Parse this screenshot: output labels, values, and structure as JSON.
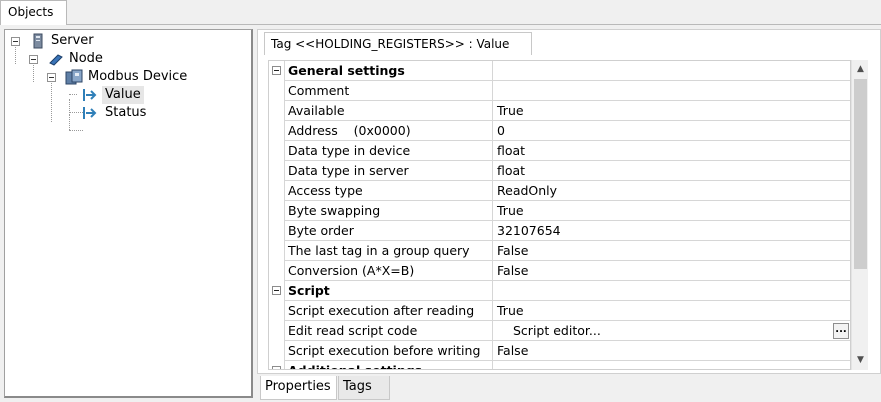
{
  "top_tab": {
    "label": "Objects"
  },
  "tree": {
    "server": "Server",
    "node": "Node",
    "device": "Modbus Device",
    "value": "Value",
    "status": "Status"
  },
  "panel": {
    "tab_label": "Tag <<HOLDING_REGISTERS>> : Value"
  },
  "grid": {
    "general_header": "General settings",
    "rows_general": [
      {
        "name": "Comment",
        "value": ""
      },
      {
        "name": "Available",
        "value": "True"
      },
      {
        "name": "Address    (0x0000)",
        "value": "0"
      },
      {
        "name": "Data type in device",
        "value": "float"
      },
      {
        "name": "Data type in server",
        "value": "float"
      },
      {
        "name": "Access type",
        "value": "ReadOnly"
      },
      {
        "name": "Byte swapping",
        "value": "True"
      },
      {
        "name": "Byte order",
        "value": "32107654"
      },
      {
        "name": "The last tag in a group query",
        "value": "False"
      },
      {
        "name": "Conversion (A*X=B)",
        "value": "False"
      }
    ],
    "script_header": "Script",
    "rows_script": [
      {
        "name": "Script execution after reading",
        "value": "True"
      },
      {
        "name": "Edit read script code",
        "value": "Script editor..."
      },
      {
        "name": "Script execution before writing",
        "value": "False"
      }
    ],
    "additional_header_partial": "Additional settings",
    "ellipsis": "..."
  },
  "scrollbar": {
    "up": "▲",
    "down": "▼"
  },
  "bottom_tabs": {
    "properties": "Properties",
    "tags": "Tags"
  },
  "colors": {
    "selected_row": "#e6e6e6",
    "tag_arrow": "#2f7fb8"
  },
  "icons": [
    "server-icon",
    "node-icon",
    "device-icon",
    "tag-arrow-icon"
  ]
}
